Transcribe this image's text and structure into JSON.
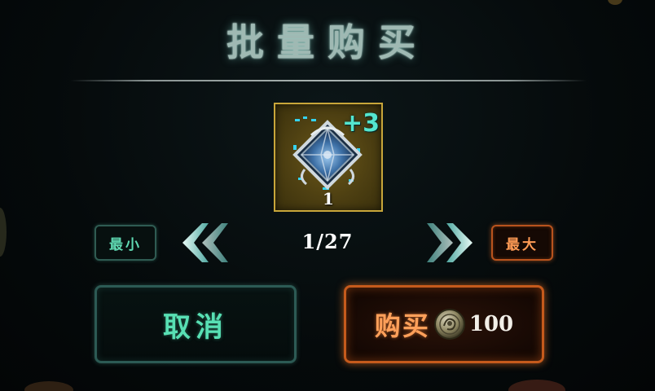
{
  "dialog": {
    "title": "批量购买"
  },
  "item": {
    "level_badge": "+3",
    "count": "1",
    "icon": "diamond-gem-icon",
    "tile_color": "#c8a63a"
  },
  "quantity_selector": {
    "min_label": "最小",
    "max_label": "最大",
    "quantity": "1/27",
    "prev_icon": "double-chevron-left-icon",
    "next_icon": "double-chevron-right-icon"
  },
  "actions": {
    "cancel_label": "取消",
    "buy_label": "购买",
    "price": "100",
    "currency_icon": "coin-icon",
    "cancel_color": "#58e0b4",
    "buy_color": "#ffa05a"
  }
}
